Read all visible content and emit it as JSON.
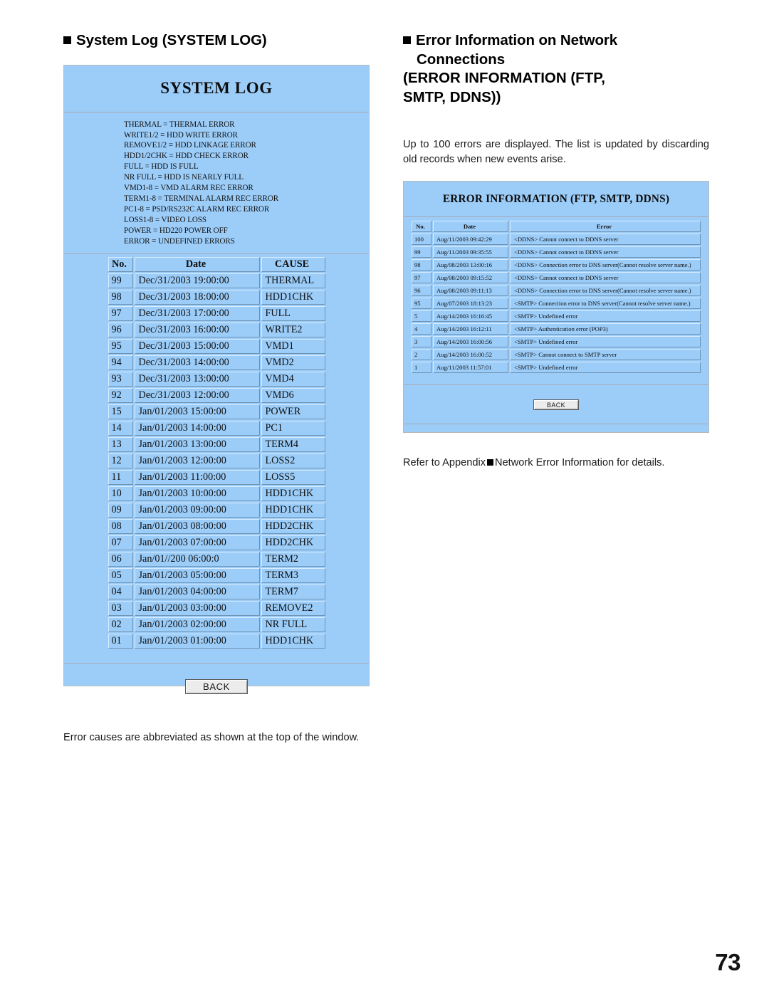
{
  "page": {
    "number": "73"
  },
  "left": {
    "heading": "System Log (SYSTEM LOG)",
    "panel": {
      "title": "SYSTEM LOG",
      "legend": [
        "THERMAL = THERMAL ERROR",
        "WRITE1/2 = HDD WRITE ERROR",
        "REMOVE1/2 = HDD LINKAGE ERROR",
        "HDD1/2CHK = HDD CHECK ERROR",
        "FULL = HDD IS FULL",
        "NR FULL = HDD IS NEARLY FULL",
        "VMD1-8 = VMD ALARM REC ERROR",
        "TERM1-8 = TERMINAL ALARM REC ERROR",
        "PC1-8 = PSD/RS232C ALARM REC ERROR",
        "LOSS1-8 = VIDEO LOSS",
        "POWER = HD220 POWER OFF",
        "ERROR = UNDEFINED ERRORS"
      ],
      "columns": [
        "No.",
        "Date",
        "CAUSE"
      ],
      "rows": [
        [
          "99",
          "Dec/31/2003 19:00:00",
          "THERMAL"
        ],
        [
          "98",
          "Dec/31/2003 18:00:00",
          "HDD1CHK"
        ],
        [
          "97",
          "Dec/31/2003 17:00:00",
          "FULL"
        ],
        [
          "96",
          "Dec/31/2003 16:00:00",
          "WRITE2"
        ],
        [
          "95",
          "Dec/31/2003 15:00:00",
          "VMD1"
        ],
        [
          "94",
          "Dec/31/2003 14:00:00",
          "VMD2"
        ],
        [
          "93",
          "Dec/31/2003 13:00:00",
          "VMD4"
        ],
        [
          "92",
          "Dec/31/2003 12:00:00",
          "VMD6"
        ],
        [
          "15",
          "Jan/01/2003 15:00:00",
          "POWER"
        ],
        [
          "14",
          "Jan/01/2003 14:00:00",
          "PC1"
        ],
        [
          "13",
          "Jan/01/2003 13:00:00",
          "TERM4"
        ],
        [
          "12",
          "Jan/01/2003 12:00:00",
          "LOSS2"
        ],
        [
          "11",
          "Jan/01/2003 11:00:00",
          "LOSS5"
        ],
        [
          "10",
          "Jan/01/2003 10:00:00",
          "HDD1CHK"
        ],
        [
          "09",
          "Jan/01/2003 09:00:00",
          "HDD1CHK"
        ],
        [
          "08",
          "Jan/01/2003 08:00:00",
          "HDD2CHK"
        ],
        [
          "07",
          "Jan/01/2003 07:00:00",
          "HDD2CHK"
        ],
        [
          "06",
          "Jan/01//200  06:00:0",
          "TERM2"
        ],
        [
          "05",
          "Jan/01/2003 05:00:00",
          "TERM3"
        ],
        [
          "04",
          "Jan/01/2003 04:00:00",
          "TERM7"
        ],
        [
          "03",
          "Jan/01/2003 03:00:00",
          "REMOVE2"
        ],
        [
          "02",
          "Jan/01/2003 02:00:00",
          "NR FULL"
        ],
        [
          "01",
          "Jan/01/2003 01:00:00",
          "HDD1CHK"
        ]
      ],
      "back_label": "BACK"
    },
    "footnote": "Error causes are abbreviated as shown at the top of the window."
  },
  "right": {
    "heading_line1": "Error Information on Network",
    "heading_line2": "Connections",
    "heading_line3": "(ERROR INFORMATION (FTP,",
    "heading_line4": "SMTP, DDNS))",
    "intro": "Up to 100 errors are displayed. The list is updated by discarding old records when new events arise.",
    "panel": {
      "title": "ERROR INFORMATION (FTP, SMTP, DDNS)",
      "columns": [
        "No.",
        "Date",
        "Error"
      ],
      "rows": [
        [
          "100",
          "Aug/11/2003 09:42:29",
          "<DDNS> Cannot connect to DDNS server"
        ],
        [
          "99",
          "Aug/11/2003 09:35:55",
          "<DDNS> Cannot connect to DDNS server"
        ],
        [
          "98",
          "Aug/08/2003 13:00:16",
          "<DDNS> Connection error to DNS server(Cannot resolve server name.)"
        ],
        [
          "97",
          "Aug/08/2003 09:15:52",
          "<DDNS> Cannot connect to DDNS server"
        ],
        [
          "96",
          "Aug/08/2003 09:11:13",
          "<DDNS> Connection error to DNS server(Cannot resolve server name.)"
        ],
        [
          "95",
          "Aug/07/2003 18:13:23",
          "<SMTP> Connection error to DNS server(Cannot resolve server name.)"
        ],
        [
          "5",
          "Aug/14/2003 16:16:45",
          "<SMTP> Undefined error"
        ],
        [
          "4",
          "Aug/14/2003 16:12:11",
          "<SMTP> Authentication error (POP3)"
        ],
        [
          "3",
          "Aug/14/2003 16:00:56",
          "<SMTP> Undefined error"
        ],
        [
          "2",
          "Aug/14/2003 16:00:52",
          "<SMTP> Cannot connect to SMTP server"
        ],
        [
          "1",
          "Aug/11/2003 11:57:01",
          "<SMTP> Undefined error"
        ]
      ],
      "back_label": "BACK"
    },
    "footnote_before": "Refer to Appendix",
    "footnote_after": "Network Error Information for details."
  },
  "colors": {
    "panel_blue": "#9CCDF9",
    "panel_border": "#b9b9b9",
    "cell_light": "#d9ecfd",
    "cell_dark": "#6d93b4",
    "button_face": "#ececec"
  }
}
